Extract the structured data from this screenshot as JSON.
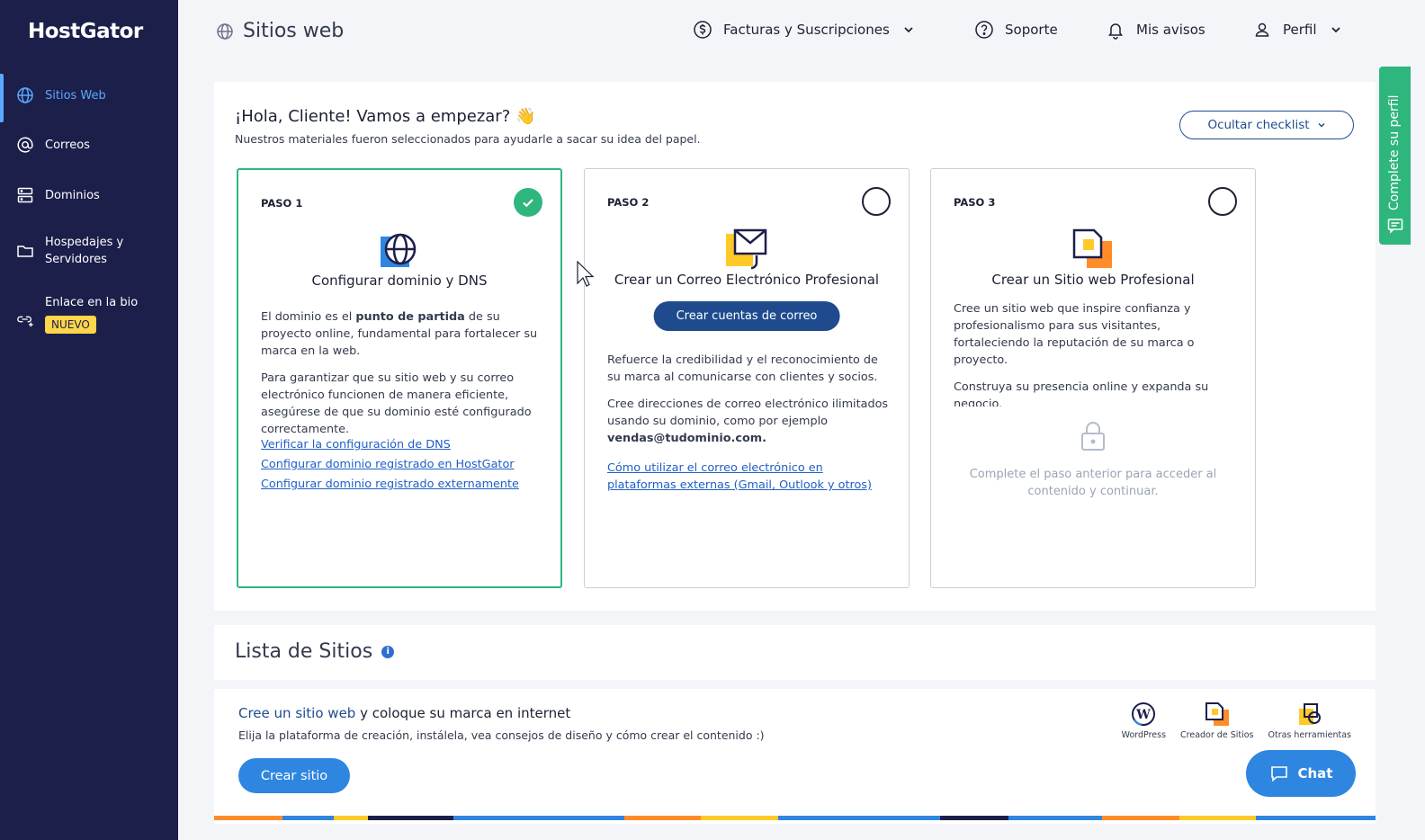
{
  "brand": "HostGator",
  "sidebar": {
    "items": [
      {
        "label": "Sitios Web",
        "icon": "globe-icon"
      },
      {
        "label": "Correos",
        "icon": "at-icon"
      },
      {
        "label": "Dominios",
        "icon": "server-icon"
      },
      {
        "label": "Hospedajes y Servidores",
        "icon": "folder-icon"
      },
      {
        "label": "Enlace en la bio",
        "icon": "link-icon",
        "badge": "NUEVO"
      }
    ]
  },
  "header": {
    "title": "Sitios web",
    "nav": {
      "billing": "Facturas y Suscripciones",
      "support": "Soporte",
      "notices": "Mis avisos",
      "profile": "Perfil"
    }
  },
  "checklist": {
    "title": "¡Hola, Cliente! Vamos a empezar?",
    "emoji": "👋",
    "subtitle": "Nuestros materiales fueron seleccionados para ayudarle a sacar su idea del papel.",
    "hide_button": "Ocultar checklist",
    "steps": [
      {
        "label": "PASO 1",
        "title": "Configurar dominio y DNS",
        "p1_before": "El dominio es el ",
        "p1_bold": "punto de partida",
        "p1_after": " de su proyecto online, fundamental para fortalecer su marca en la web.",
        "p2": "Para garantizar que su sitio web y su correo electrónico funcionen de manera eficiente, asegúrese de que su dominio esté configurado correctamente.",
        "links": [
          "Verificar la configuración de DNS",
          "Configurar dominio registrado en HostGator",
          "Configurar dominio registrado externamente"
        ]
      },
      {
        "label": "PASO 2",
        "title": "Crear un Correo Electrónico Profesional",
        "button": "Crear cuentas de correo",
        "p1": "Refuerce la credibilidad y el reconocimiento de su marca al comunicarse con clientes y socios.",
        "p2_before": "Cree direcciones de correo electrónico ilimitados usando su dominio, como por ejemplo ",
        "p2_bold": "vendas@tudominio.com.",
        "link": "Cómo utilizar el correo electrónico en plataformas externas (Gmail, Outlook y otros)"
      },
      {
        "label": "PASO 3",
        "title": "Crear un Sitio web Profesional",
        "p1": "Cree un sitio web que inspire confianza y profesionalismo para sus visitantes, fortaleciendo la reputación de su marca o proyecto.",
        "p2": "Construya su presencia online y expanda su negocio.",
        "locked_text": "Complete el paso anterior para acceder al contenido y continuar."
      }
    ]
  },
  "sites": {
    "title": "Lista de Sitios",
    "info": "i",
    "card": {
      "title_highlight": "Cree un sitio web",
      "title_rest": " y coloque su marca en internet",
      "subtitle": "Elija la plataforma de creación, instálela, vea consejos de diseño y cómo crear el contenido :)",
      "button": "Crear sitio",
      "platforms": [
        "WordPress",
        "Creador de Sitios",
        "Otras herramientas"
      ]
    }
  },
  "side_tab": "Complete su perfil",
  "chat": "Chat",
  "colors": {
    "sidebar": "#1c1f4a",
    "accent_green": "#2eb67d",
    "primary": "#1f4b8e",
    "action_blue": "#2f86e0",
    "active_nav": "#5aa9ff"
  }
}
